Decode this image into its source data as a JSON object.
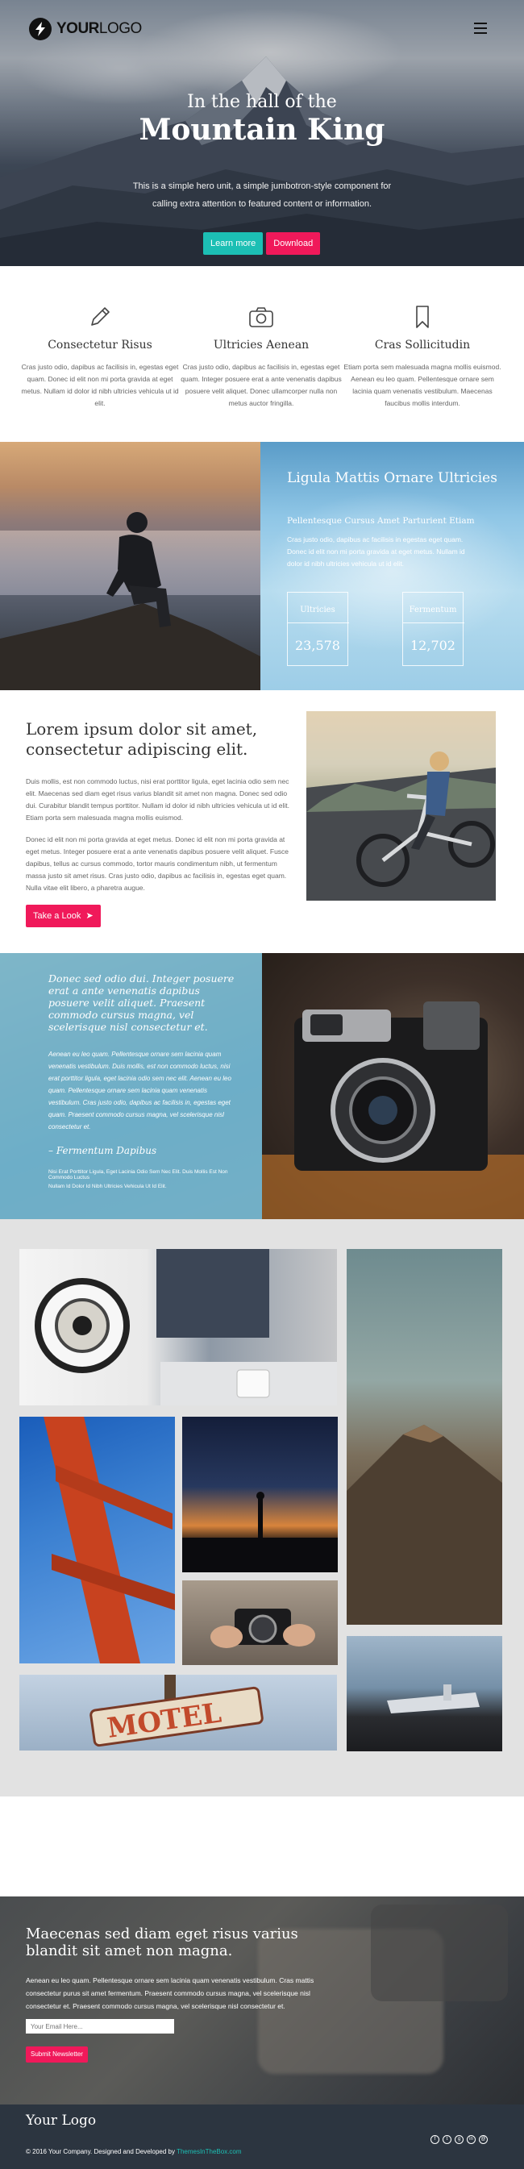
{
  "header": {
    "logo_bold": "YOUR",
    "logo_light": "LOGO",
    "menu_icon": "hamburger-icon"
  },
  "hero": {
    "subtitle": "In the hall of the",
    "title": "Mountain King",
    "description": "This is a simple hero unit, a simple jumbotron-style component for calling extra attention to featured content or information.",
    "primary_button": "Learn more",
    "secondary_button": "Download"
  },
  "features": [
    {
      "icon": "pencil-icon",
      "title": "Consectetur Risus",
      "text": "Cras justo odio, dapibus ac facilisis in, egestas eget quam. Donec id elit non mi porta gravida at eget metus. Nullam id dolor id nibh ultricies vehicula ut id elit."
    },
    {
      "icon": "camera-icon",
      "title": "Ultricies Aenean",
      "text": "Cras justo odio, dapibus ac facilisis in, egestas eget quam. Integer posuere erat a ante venenatis dapibus posuere velit aliquet. Donec ullamcorper nulla non metus auctor fringilla."
    },
    {
      "icon": "bookmark-icon",
      "title": "Cras Sollicitudin",
      "text": "Etiam porta sem malesuada magna mollis euismod. Aenean eu leo quam. Pellentesque ornare sem lacinia quam venenatis vestibulum. Maecenas faucibus mollis interdum."
    }
  ],
  "stats_section": {
    "title": "Ligula Mattis Ornare Ultricies",
    "subtitle": "Pellentesque Cursus Amet Parturient Etiam",
    "text": "Cras justo odio, dapibus ac facilisis in egestas eget quam. Donec id elit non mi porta gravida at eget metus. Nullam id dolor id nibh ultricies vehicula ut id elit.",
    "stats": [
      {
        "label": "Ultricies",
        "value": "23,578"
      },
      {
        "label": "Fermentum",
        "value": "12,702"
      }
    ]
  },
  "article": {
    "title": "Lorem ipsum dolor sit amet, consectetur adipiscing elit.",
    "paragraph_1": "Duis mollis, est non commodo luctus, nisi erat porttitor ligula, eget lacinia odio sem nec elit. Maecenas sed diam eget risus varius blandit sit amet non magna. Donec sed odio dui. Curabitur blandit tempus porttitor. Nullam id dolor id nibh ultricies vehicula ut id elit. Etiam porta sem malesuada magna mollis euismod.",
    "paragraph_2": "Donec id elit non mi porta gravida at eget metus. Donec id elit non mi porta gravida at eget metus. Integer posuere erat a ante venenatis dapibus posuere velit aliquet. Fusce dapibus, tellus ac cursus commodo, tortor mauris condimentum nibh, ut fermentum massa justo sit amet risus. Cras justo odio, dapibus ac facilisis in, egestas eget quam. Nulla vitae elit libero, a pharetra augue.",
    "button": "Take a Look",
    "button_icon": "arrow-circle-right-icon"
  },
  "quote_section": {
    "quote": "Donec sed odio dui. Integer posuere erat a ante venenatis dapibus posuere velit aliquet. Praesent commodo cursus magna, vel scelerisque nisl consectetur et.",
    "paragraph": "Aenean eu leo quam. Pellentesque ornare sem lacinia quam venenatis vestibulum. Duis mollis, est non commodo luctus, nisi erat porttitor ligula, eget lacinia odio sem nec elit. Aenean eu leo quam. Pellentesque ornare sem lacinia quam venenatis vestibulum. Cras justo odio, dapibus ac facilisis in, egestas eget quam. Praesent commodo cursus magna, vel scelerisque nisl consectetur et.",
    "author": "– Fermentum Dapibus",
    "meta_1": "Nisi Erat Porttitor Ligula, Eget Lacinia Odio Sem Nec Elit. Duis Mollis Est Non Commodo Luctus",
    "meta_2": "Nullam Id Dolor Id Nibh Ultricies Vehicula Ut Id Elit."
  },
  "gallery": {
    "sign_text": "MOTEL"
  },
  "newsletter": {
    "title": "Maecenas sed diam eget risus varius blandit sit amet non magna.",
    "text": "Aenean eu leo quam. Pellentesque ornare sem lacinia quam venenatis vestibulum. Cras mattis consectetur purus sit amet fermentum. Praesent commodo cursus magna, vel scelerisque nisl consectetur et. Praesent commodo cursus magna, vel scelerisque nisl consectetur et.",
    "email_placeholder": "Your Email Here...",
    "button": "Submit Newsletter"
  },
  "footer": {
    "logo": "Your Logo",
    "copyright": "© 2016 Your Company. Designed and Developed by",
    "credit_link": "ThemesInTheBox.com",
    "social": [
      "facebook-icon",
      "twitter-icon",
      "google-plus-icon",
      "linkedin-icon",
      "email-icon"
    ]
  },
  "colors": {
    "accent_teal": "#1cbfb4",
    "accent_pink": "#f0195a",
    "stats_blue": "#8fc6e6",
    "footer_bg": "#2c3540"
  }
}
